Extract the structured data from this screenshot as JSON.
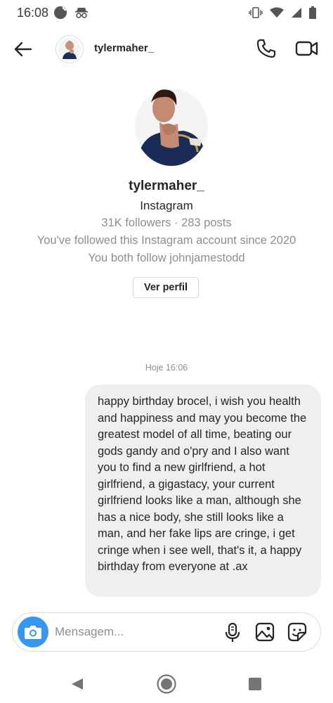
{
  "status_bar": {
    "time": "16:08",
    "left_icons": [
      "notification-dot-icon",
      "incognito-icon"
    ],
    "right_icons": [
      "vibrate-icon",
      "wifi-icon",
      "signal-icon",
      "battery-icon"
    ]
  },
  "header": {
    "username": "tylermaher_",
    "back_icon": "arrow-left-icon",
    "call_icon": "phone-icon",
    "video_icon": "video-camera-icon"
  },
  "profile": {
    "name": "tylermaher_",
    "platform": "Instagram",
    "stats": "31K followers · 283 posts",
    "follow_since": "You've followed this Instagram account since 2020",
    "mutual": "You both follow johnjamestodd",
    "view_profile_label": "Ver perfil"
  },
  "conversation": {
    "timestamp": "Hoje 16:06",
    "messages": [
      {
        "sender": "me",
        "text": "happy birthday brocel, i wish you health and happiness and may you become the greatest model of all time, beating our gods gandy and o'pry and I also want you to find a new girlfriend, a hot girlfriend, a gigastacy, your current girlfriend looks like a man, although she has a nice body, she still looks like a man, and her fake lips are cringe, i get cringe when i see well, that's it, a happy birthday from everyone at .ax"
      }
    ]
  },
  "composer": {
    "placeholder": "Mensagem...",
    "value": "",
    "camera_icon": "camera-icon",
    "mic_icon": "microphone-icon",
    "gallery_icon": "image-icon",
    "sticker_icon": "sticker-icon"
  },
  "nav_bar": {
    "back_icon": "triangle-back-icon",
    "home_icon": "circle-home-icon",
    "recents_icon": "square-recents-icon"
  },
  "colors": {
    "accent": "#3797f0",
    "bubble": "#efefef",
    "muted_text": "#8e8e8e",
    "primary_text": "#262626",
    "border": "#dbdbdb"
  }
}
